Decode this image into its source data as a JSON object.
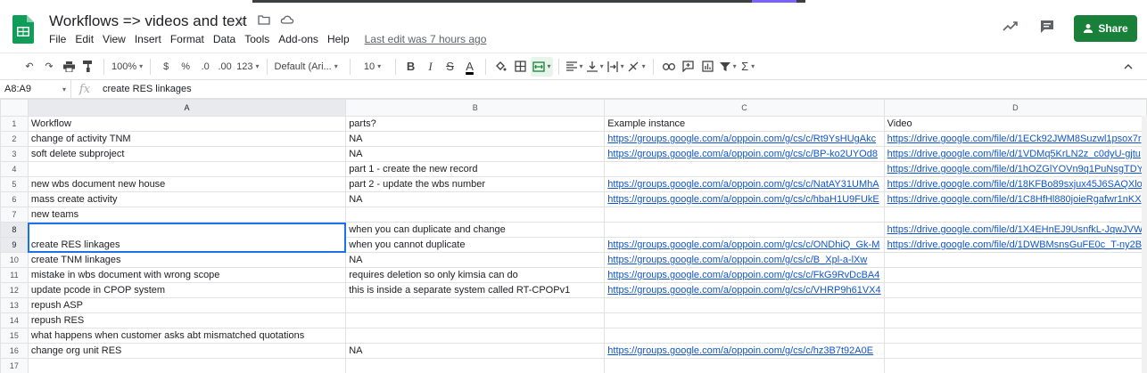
{
  "app": {
    "title": "Workflows => videos and text",
    "menu": [
      "File",
      "Edit",
      "View",
      "Insert",
      "Format",
      "Data",
      "Tools",
      "Add-ons",
      "Help"
    ],
    "last_edit": "Last edit was 7 hours ago",
    "share_label": "Share",
    "brand_color": "#188038"
  },
  "toolbar": {
    "zoom": "100%",
    "currency": "$",
    "percent": "%",
    "dec_decrease": ".0",
    "dec_increase": ".00",
    "more_formats": "123",
    "font": "Default (Ari...",
    "font_size": "10",
    "bold": "B",
    "italic": "I",
    "strike": "S",
    "text_color": "A",
    "sigma": "Σ"
  },
  "formula_bar": {
    "name_box": "A8:A9",
    "fx": "fx",
    "content": "create RES linkages"
  },
  "columns": [
    "A",
    "B",
    "C",
    "D"
  ],
  "rows": [
    {
      "n": "1",
      "a": "Workflow",
      "b": "parts?",
      "c": "Example instance",
      "d": "Video"
    },
    {
      "n": "2",
      "a": "change of activity TNM",
      "b": "NA",
      "c": "https://groups.google.com/a/oppoin.com/g/cs/c/Rt9YsHUgAkc",
      "d": "https://drive.google.com/file/d/1ECk92JWM8Suzwl1psox7r"
    },
    {
      "n": "3",
      "a": "soft delete subproject",
      "b": "NA",
      "c": "https://groups.google.com/a/oppoin.com/g/cs/c/BP-ko2UYOd8",
      "d": "https://drive.google.com/file/d/1VDMq5KrLN2z_c0dyU-gjtu"
    },
    {
      "n": "4",
      "a": "",
      "b": "part 1 - create the new record",
      "c": "",
      "d": "https://drive.google.com/file/d/1hOZGlYOVn9q1PuNsgTDY"
    },
    {
      "n": "5",
      "a": "new wbs document new house",
      "b": "part 2 - update the wbs number",
      "c": "https://groups.google.com/a/oppoin.com/g/cs/c/NatAY31UMhA",
      "d": "https://drive.google.com/file/d/18KFBo89sxjux45J6SAQXlo"
    },
    {
      "n": "6",
      "a": "mass create activity",
      "b": "NA",
      "c": "https://groups.google.com/a/oppoin.com/g/cs/c/hbaH1U9FUkE",
      "d": "https://drive.google.com/file/d/1C8HfHl880joieRgafwr1nKX"
    },
    {
      "n": "7",
      "a": "new teams",
      "b": "",
      "c": "",
      "d": ""
    },
    {
      "n": "8",
      "a": "",
      "b": "when you can duplicate and change",
      "c": "",
      "d": "https://drive.google.com/file/d/1X4EHnEJ9UsnfkL-JqwJVW"
    },
    {
      "n": "9",
      "a": "create RES linkages",
      "b": "when you cannot duplicate",
      "c": "https://groups.google.com/a/oppoin.com/g/cs/c/ONDhiQ_Gk-M",
      "d": "https://drive.google.com/file/d/1DWBMsnsGuFE0c_T-ny2B"
    },
    {
      "n": "10",
      "a": "create TNM linkages",
      "b": "NA",
      "c": "https://groups.google.com/a/oppoin.com/g/cs/c/B_Xpl-a-lXw",
      "d": ""
    },
    {
      "n": "11",
      "a": "mistake in wbs document with wrong scope",
      "b": "requires deletion so only kimsia can do",
      "c": "https://groups.google.com/a/oppoin.com/g/cs/c/FkG9RvDcBA4",
      "d": ""
    },
    {
      "n": "12",
      "a": "update pcode in CPOP system",
      "b": "this is inside a separate system called RT-CPOPv1",
      "c": "https://groups.google.com/a/oppoin.com/g/cs/c/VHRP9h61VX4",
      "d": ""
    },
    {
      "n": "13",
      "a": "repush ASP",
      "b": "",
      "c": "",
      "d": ""
    },
    {
      "n": "14",
      "a": "repush RES",
      "b": "",
      "c": "",
      "d": ""
    },
    {
      "n": "15",
      "a": "what happens when customer asks abt mismatched quotations",
      "b": "",
      "c": "",
      "d": ""
    },
    {
      "n": "16",
      "a": "change org unit RES",
      "b": "NA",
      "c": "https://groups.google.com/a/oppoin.com/g/cs/c/hz3B7t92A0E",
      "d": ""
    },
    {
      "n": "17",
      "a": "",
      "b": "",
      "c": "",
      "d": ""
    }
  ]
}
